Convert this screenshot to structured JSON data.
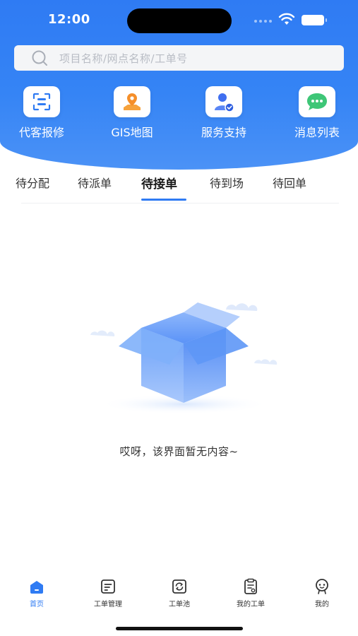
{
  "status_bar": {
    "time": "12:00"
  },
  "search": {
    "placeholder": "项目名称/网点名称/工单号",
    "icon": "search-icon"
  },
  "quick_actions": [
    {
      "label": "代客报修",
      "icon": "scan-icon"
    },
    {
      "label": "GIS地图",
      "icon": "map-pin-icon"
    },
    {
      "label": "服务支持",
      "icon": "support-user-icon"
    },
    {
      "label": "消息列表",
      "icon": "chat-bubble-icon"
    }
  ],
  "tabs": [
    {
      "label": "待分配"
    },
    {
      "label": "待派单"
    },
    {
      "label": "待接单"
    },
    {
      "label": "待到场"
    },
    {
      "label": "待回单"
    }
  ],
  "active_tab_index": 2,
  "empty_state": {
    "message": "哎呀，该界面暂无内容~",
    "icon": "empty-box-icon"
  },
  "bottom_nav": [
    {
      "label": "首页",
      "icon": "home-icon"
    },
    {
      "label": "工单管理",
      "icon": "document-icon"
    },
    {
      "label": "工单池",
      "icon": "refresh-box-icon"
    },
    {
      "label": "我的工单",
      "icon": "clipboard-icon"
    },
    {
      "label": "我的",
      "icon": "face-icon"
    }
  ],
  "active_nav_index": 0,
  "colors": {
    "primary": "#2f7bf3",
    "text": "#333333",
    "placeholder": "#b8bcc4"
  }
}
